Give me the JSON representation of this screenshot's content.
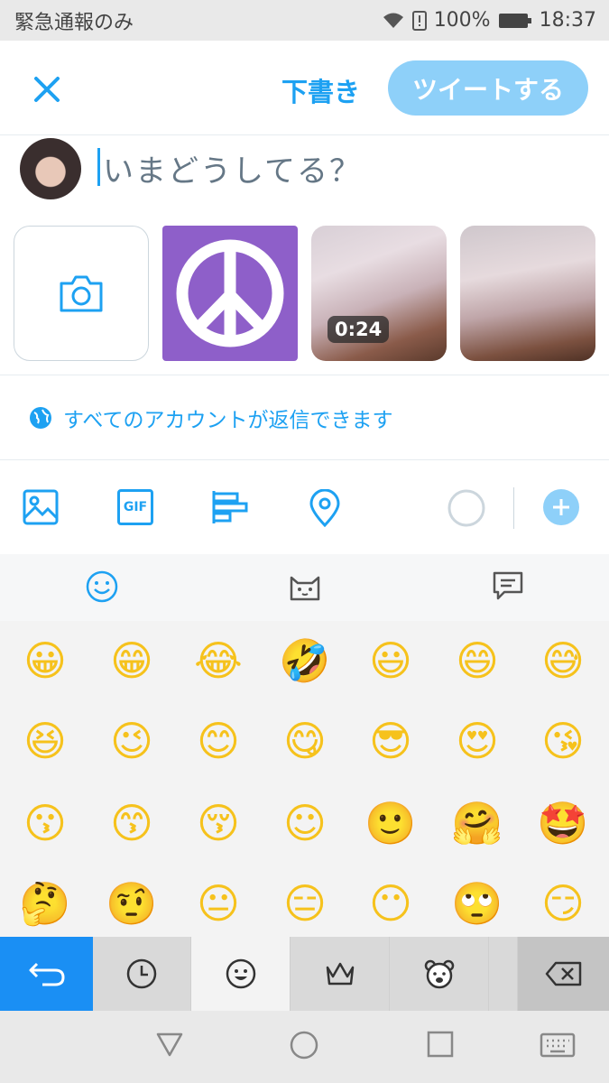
{
  "status": {
    "carrier": "緊急通報のみ",
    "battery": "100%",
    "time": "18:37"
  },
  "header": {
    "draft_label": "下書き",
    "tweet_label": "ツイートする"
  },
  "compose": {
    "placeholder": "いまどうしてる？"
  },
  "media": {
    "video_duration": "0:24"
  },
  "reply": {
    "label": "すべてのアカウントが返信できます"
  },
  "toolbar": {
    "items": [
      "image-icon",
      "gif-icon",
      "poll-icon",
      "location-icon",
      "char-count-ring",
      "add-tweet-button"
    ],
    "gif_text": "GIF"
  },
  "keyboard": {
    "tabs": [
      "emoji-tab",
      "kaomoji-tab",
      "sticker-tab"
    ],
    "bottom_keys": [
      "back-key",
      "recent-key",
      "smileys-key",
      "crown-key",
      "animal-key",
      "delete-key"
    ],
    "emoji": [
      "😀",
      "😁",
      "😂",
      "🤣",
      "😃",
      "😄",
      "😅",
      "😆",
      "😉",
      "😊",
      "😋",
      "😎",
      "😍",
      "😘",
      "😗",
      "😙",
      "😚",
      "☺",
      "🙂",
      "🤗",
      "🤩",
      "🤔",
      "🤨",
      "😐",
      "😑",
      "😶",
      "🙄",
      "😏"
    ]
  },
  "colors": {
    "accent": "#1da1f2",
    "tweet_button": "#8ed0f9",
    "keyboard_active": "#1a8ff4"
  }
}
